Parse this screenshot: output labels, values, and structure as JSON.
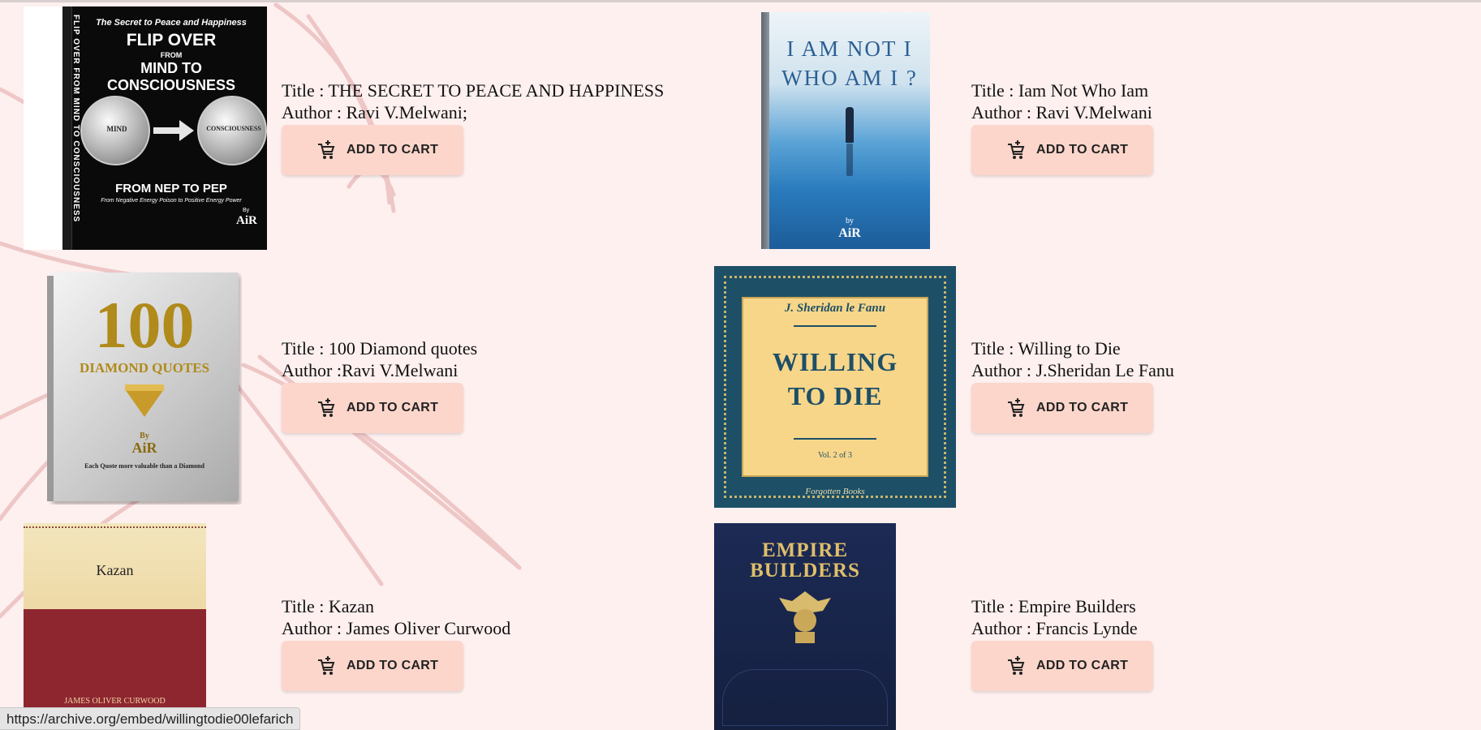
{
  "books": [
    {
      "title_line": "Title : THE SECRET TO PEACE AND HAPPINESS",
      "author_line": "Author : Ravi V.Melwani;",
      "cart_label": "ADD TO CART",
      "cover": {
        "tagline": "The Secret to Peace and Happiness",
        "heading1": "FLIP OVER",
        "heading_from": "FROM",
        "heading2": "MIND TO CONSCIOUSNESS",
        "coin_left": "MIND",
        "coin_right": "CONSCIOUSNESS",
        "bottom_title": "FROM NEP TO PEP",
        "bottom_sub": "From Negative Energy Poison to Positive Energy Power",
        "by": "By",
        "brand": "AiR",
        "spine": "FLIP OVER FROM MIND TO CONSCIOUSNESS"
      }
    },
    {
      "title_line": "Title : Iam Not Who Iam",
      "author_line": "Author : Ravi V.Melwani",
      "cart_label": "ADD TO CART",
      "cover": {
        "line1": "I AM NOT I",
        "line2": "WHO AM I ?",
        "by": "by",
        "brand": "AiR"
      }
    },
    {
      "title_line": "Title : 100 Diamond quotes",
      "author_line": "Author :Ravi V.Melwani",
      "cart_label": "ADD TO CART",
      "cover": {
        "number": "100",
        "subtitle": "DIAMOND QUOTES",
        "by": "By",
        "brand": "AiR",
        "footer": "Each Quote more valuable than a Diamond"
      }
    },
    {
      "title_line": "Title : Willing to Die",
      "author_line": "Author : J.Sheridan Le Fanu",
      "cart_label": "ADD TO CART",
      "cover": {
        "author": "J. Sheridan le Fanu",
        "line1": "WILLING",
        "line2": "TO DIE",
        "volume": "Vol. 2 of 3",
        "publisher": "Forgotten Books"
      }
    },
    {
      "title_line": "Title : Kazan",
      "author_line": "Author : James Oliver Curwood",
      "cart_label": "ADD TO CART",
      "cover": {
        "title": "Kazan",
        "author": "JAMES OLIVER CURWOOD"
      }
    },
    {
      "title_line": "Title : Empire Builders",
      "author_line": "Author : Francis Lynde",
      "cart_label": "ADD TO CART",
      "cover": {
        "line1": "EMPIRE",
        "line2": "BUILDERS"
      }
    }
  ],
  "status_url": "https://archive.org/embed/willingtodie00lefarich",
  "colors": {
    "background": "#fdf0ef",
    "button": "#fcd6cb",
    "petal_stroke": "#e9b8b8"
  }
}
